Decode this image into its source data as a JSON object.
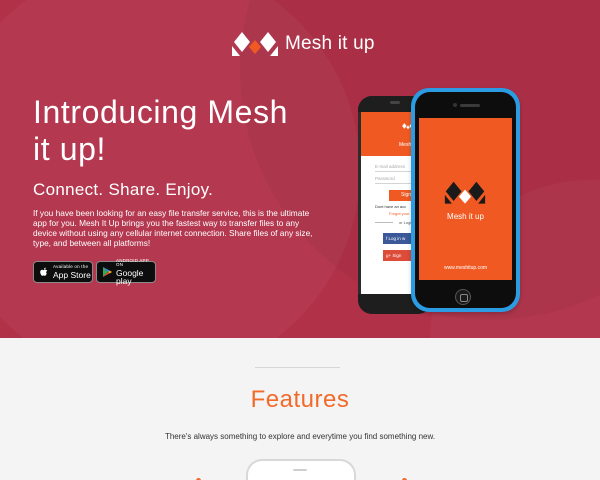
{
  "brand": {
    "name": "Mesh it up",
    "accent": "#f05a22",
    "hero_bg": "#b13149"
  },
  "hero": {
    "headline": "Introducing Mesh it up!",
    "tagline": "Connect. Share. Enjoy.",
    "description": "If you have been looking for an easy file transfer service, this is the ultimate app for you. Mesh It Up brings you the fastest way to transfer files to any device without using any cellular internet connection. Share files of any size, type, and between all platforms!"
  },
  "store_buttons": {
    "apple": {
      "small": "Available on the",
      "big": "App Store",
      "icon": "apple-icon"
    },
    "google": {
      "small": "ANDROID APP ON",
      "big": "Google play",
      "icon": "google-play-icon"
    }
  },
  "android_screen": {
    "title": "Mesh",
    "email_placeholder": "E-mail address",
    "password_placeholder": "Password",
    "signin_label": "Sign",
    "no_account": "Dont have an acc",
    "forgot": "Forgot your",
    "or_login": "or Logi",
    "facebook": "Log in w",
    "google": "Sign"
  },
  "iphone_screen": {
    "app_name": "Mesh it up",
    "url": "www.meshitup.com"
  },
  "features": {
    "title": "Features",
    "subtitle": "There's always something to explore and everytime you find something new."
  }
}
